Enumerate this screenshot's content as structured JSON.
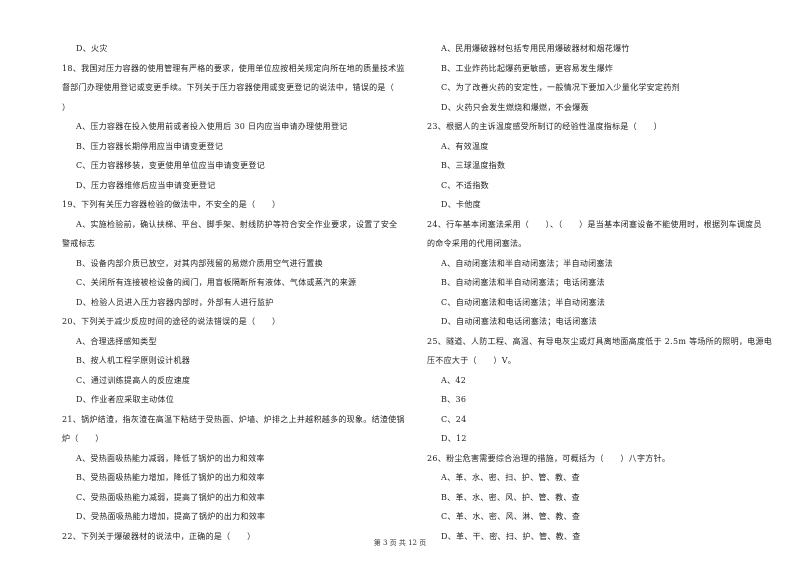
{
  "page": {
    "footer": "第 3 页 共 12 页"
  },
  "left_column": [
    {
      "text": "D、火灾",
      "type": "option"
    },
    {
      "text": "18、我国对压力容器的使用管理有严格的要求，使用单位应按相关规定向所在地的质量技术监",
      "type": "question"
    },
    {
      "text": "督部门办理使用登记或变更手续。下列关于压力容器使用或变更登记的说法中，错误的是（",
      "type": "question-cont"
    },
    {
      "text": "）",
      "type": "question-cont"
    },
    {
      "text": "A、压力容器在投入使用前或者投入使用后 30 日内应当申请办理使用登记",
      "type": "option"
    },
    {
      "text": "B、压力容器长期停用应当申请变更登记",
      "type": "option"
    },
    {
      "text": "C、压力容器移装，变更使用单位应当申请变更登记",
      "type": "option"
    },
    {
      "text": "D、压力容器维修后应当申请变更登记",
      "type": "option"
    },
    {
      "text": "19、下列有关压力容器检验的做法中，不安全的是（　　）",
      "type": "question"
    },
    {
      "text": "A、实施检验前，确认扶梯、平台、脚手架、射线防护等符合安全作业要求，设置了安全",
      "type": "option"
    },
    {
      "text": "警戒标志",
      "type": "question-cont"
    },
    {
      "text": "B、设备内部介质已放空，对其内部残留的易燃介质用空气进行置换",
      "type": "option"
    },
    {
      "text": "C、关闭所有连接被检设备的阀门，用盲板隔断所有液体、气体或蒸汽的来源",
      "type": "option"
    },
    {
      "text": "D、检验人员进入压力容器内部时，外部有人进行监护",
      "type": "option"
    },
    {
      "text": "20、下列关于减少反应时间的途径的说法错误的是（　　）",
      "type": "question"
    },
    {
      "text": "A、合理选择感知类型",
      "type": "option"
    },
    {
      "text": "B、按人机工程学原则设计机器",
      "type": "option"
    },
    {
      "text": "C、通过训练提高人的反应速度",
      "type": "option"
    },
    {
      "text": "D、作业者应采取主动体位",
      "type": "option"
    },
    {
      "text": "21、锅炉结渣，指灰渣在高温下粘结于受热面、炉墙、炉排之上并越积越多的现象。结渣使锅",
      "type": "question"
    },
    {
      "text": "炉（　　）",
      "type": "question-cont"
    },
    {
      "text": "A、受热面吸热能力减弱，降低了锅炉的出力和效率",
      "type": "option"
    },
    {
      "text": "B、受热面吸热能力增加，降低了锅炉的出力和效率",
      "type": "option"
    },
    {
      "text": "C、受热面吸热能力减弱，提高了锅炉的出力和效率",
      "type": "option"
    },
    {
      "text": "D、受热面吸热能力增加，提高了锅炉的出力和效率",
      "type": "option"
    },
    {
      "text": "22、下列关于爆破器材的说法中，正确的是（　　）",
      "type": "question"
    }
  ],
  "right_column": [
    {
      "text": "A、民用爆破器材包括专用民用爆破器材和烟花爆竹",
      "type": "option"
    },
    {
      "text": "B、工业炸药比起爆药更敏感，更容易发生爆炸",
      "type": "option"
    },
    {
      "text": "C、为了改善火药的安定性，一般情况下要加入少量化学安定药剂",
      "type": "option"
    },
    {
      "text": "D、火药只会发生燃烧和爆燃，不会爆轰",
      "type": "option"
    },
    {
      "text": "23、根据人的主诉温度感受所制订的经验性温度指标是（　　）",
      "type": "question"
    },
    {
      "text": "A、有效温度",
      "type": "option"
    },
    {
      "text": "B、三球温度指数",
      "type": "option"
    },
    {
      "text": "C、不适指数",
      "type": "option"
    },
    {
      "text": "D、卡他度",
      "type": "option"
    },
    {
      "text": "24、行车基本闭塞法采用（　　）、（　　）是当基本闭塞设备不能使用时，根据列车调度员",
      "type": "question"
    },
    {
      "text": "的命令采用的代用闭塞法。",
      "type": "question-cont"
    },
    {
      "text": "A、自动闭塞法和半自动闭塞法；半自动闭塞法",
      "type": "option"
    },
    {
      "text": "B、自动闭塞法和半自动闭塞法；电话闭塞法",
      "type": "option"
    },
    {
      "text": "C、自动闭塞法和电话闭塞法；半自动闭塞法",
      "type": "option"
    },
    {
      "text": "D、自动闭塞法和电话闭塞法；电话闭塞法",
      "type": "option"
    },
    {
      "text": "25、隧道、人防工程、高温、有导电灰尘或灯具离地面高度低于 2.5m 等场所的照明，电源电",
      "type": "question"
    },
    {
      "text": "压不应大于（　　）V。",
      "type": "question-cont"
    },
    {
      "text": "A、42",
      "type": "option"
    },
    {
      "text": "B、36",
      "type": "option"
    },
    {
      "text": "C、24",
      "type": "option"
    },
    {
      "text": "D、12",
      "type": "option"
    },
    {
      "text": "26、粉尘危害需要综合治理的措施，可概括为（　　）八字方针。",
      "type": "question"
    },
    {
      "text": "A、革、水、密、扫、护、管、教、查",
      "type": "option"
    },
    {
      "text": "B、革、水、密、风、护、管、教、查",
      "type": "option"
    },
    {
      "text": "C、革、水、密、风、淋、管、教、查",
      "type": "option"
    },
    {
      "text": "D、革、干、密、扫、护、管、教、查",
      "type": "option"
    }
  ]
}
